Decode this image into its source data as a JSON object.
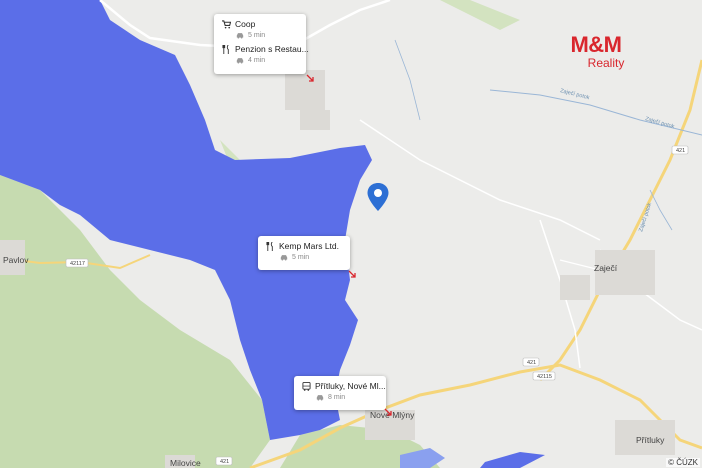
{
  "map": {
    "towns": [
      {
        "name": "Pavlov"
      },
      {
        "name": "Zaječí"
      },
      {
        "name": "Nové Mlýny"
      },
      {
        "name": "Přítluky"
      },
      {
        "name": "Milovice"
      }
    ],
    "roads": [
      {
        "number": "42117"
      },
      {
        "number": "421"
      },
      {
        "number": "42115"
      },
      {
        "number": "421"
      },
      {
        "number": "421"
      }
    ],
    "streams": [
      {
        "name": "Zaječí potok"
      },
      {
        "name": "Zaječí potok"
      },
      {
        "name": "Zaječí potok"
      }
    ]
  },
  "pois": [
    {
      "name": "Coop",
      "time": "5 min",
      "icon": "cart-icon"
    },
    {
      "name": "Penzion s Restau...",
      "time": "4 min",
      "icon": "restaurant-icon"
    },
    {
      "name": "Kemp Mars Ltd.",
      "time": "5 min",
      "icon": "restaurant-icon"
    },
    {
      "name": "Přítluky, Nové Ml...",
      "time": "8 min",
      "icon": "bus-icon"
    }
  ],
  "logo": {
    "brand": "M&M",
    "subtitle": "Reality"
  },
  "attribution": "© ČÚZK",
  "colors": {
    "water": "#5b6ee8",
    "land": "#ececea",
    "green": "#c6dbb0",
    "road": "#f5d57a",
    "brand": "#d9262d",
    "pin": "#2d6fd4"
  }
}
